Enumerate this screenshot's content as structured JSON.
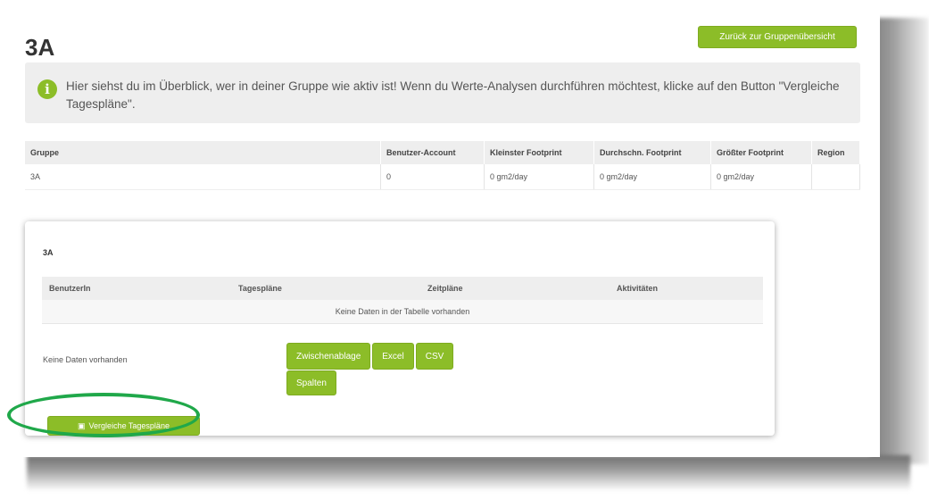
{
  "header": {
    "group_title": "3A",
    "back_button": "Zurück zur Gruppenübersicht"
  },
  "info": {
    "icon": "info-icon",
    "text": "Hier siehst du im Überblick, wer in deiner Gruppe wie aktiv ist! Wenn du Werte-Analysen durchführen möchtest, klicke auf den Button \"Vergleiche Tagespläne\"."
  },
  "overview_table": {
    "headers": [
      "Gruppe",
      "Benutzer-Account",
      "Kleinster Footprint",
      "Durchschn. Footprint",
      "Größter Footprint",
      "Region"
    ],
    "rows": [
      [
        "3A",
        "0",
        "0 gm2/day",
        "0 gm2/day",
        "0 gm2/day",
        ""
      ]
    ]
  },
  "card": {
    "title": "3A",
    "headers": [
      "BenutzerIn",
      "Tagespläne",
      "Zeitpläne",
      "Aktivitäten"
    ],
    "empty_message": "Keine Daten in der Tabelle vorhanden",
    "no_data_text": "Keine Daten vorhanden",
    "export_buttons": [
      "Zwischenablage",
      "Excel",
      "CSV"
    ],
    "columns_button": "Spalten",
    "compare_button": "Vergleiche Tagespläne",
    "compare_icon": "camera-icon"
  },
  "colors": {
    "accent_green": "#8cbd28",
    "highlight_ellipse": "#20a84a"
  }
}
